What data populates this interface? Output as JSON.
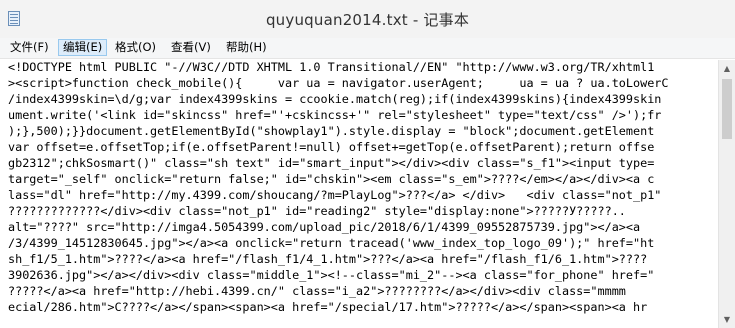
{
  "window": {
    "title": "quyuquan2014.txt - 记事本"
  },
  "menu": [
    {
      "label": "文件(F)"
    },
    {
      "label": "编辑(E)"
    },
    {
      "label": "格式(O)"
    },
    {
      "label": "查看(V)"
    },
    {
      "label": "帮助(H)"
    }
  ],
  "editor": {
    "lines": [
      "<!DOCTYPE html PUBLIC \"-//W3C//DTD XHTML 1.0 Transitional//EN\" \"http://www.w3.org/TR/xhtml1",
      "><script>function check_mobile(){     var ua = navigator.userAgent;     ua = ua ? ua.toLowerC",
      "/index4399skin=\\d/g;var index4399skins = ccookie.match(reg);if(index4399skins){index4399skin",
      "ument.write('<link id=\"skincss\" href=\"'+cskincss+'\" rel=\"stylesheet\" type=\"text/css\" />');fr",
      ");},500);}}document.getElementById(\"showplay1\").style.display = \"block\";document.getElement",
      "var offset=e.offsetTop;if(e.offsetParent!=null) offset+=getTop(e.offsetParent);return offse",
      "gb2312\";chkSosmart()\" class=\"sh text\" id=\"smart_input\"></div><div class=\"s_f1\"><input type=",
      "target=\"_self\" onclick=\"return false;\" id=\"chskin\"><em class=\"s_em\">????</em></a></div><a c",
      "lass=\"dl\" href=\"http://my.4399.com/shoucang/?m=PlayLog\">???</a> </div>   <div class=\"not_p1\"",
      "?????????????</div><div class=\"not_p1\" id=\"reading2\" style=\"display:none\">?????У?????..",
      "alt=\"????\" src=\"http://imga4.5054399.com/upload_pic/2018/6/1/4399_09552875739.jpg\"></a><a",
      "/3/4399_14512830645.jpg\"></a><a onclick=\"return tracead('www_index_top_logo_09');\" href=\"ht",
      "sh_f1/5_1.htm\">????</a><a href=\"/flash_f1/4_1.htm\">???</a><a href=\"/flash_f1/6_1.htm\">????",
      "3902636.jpg\"></a></div><div class=\"middle_1\"><!--class=\"mi_2\"--><a class=\"for_phone\" href=\"",
      "?????</a><a href=\"http://hebi.4399.cn/\" class=\"i_a2\">????????</a></div><div class=\"mmmm",
      "ecial/286.htm\">C????</a></span><span><a href=\"/special/17.htm\">?????</a></span><span><a hr"
    ]
  },
  "scrollbar": {
    "up_arrow": "▲",
    "down_arrow": "▼"
  }
}
